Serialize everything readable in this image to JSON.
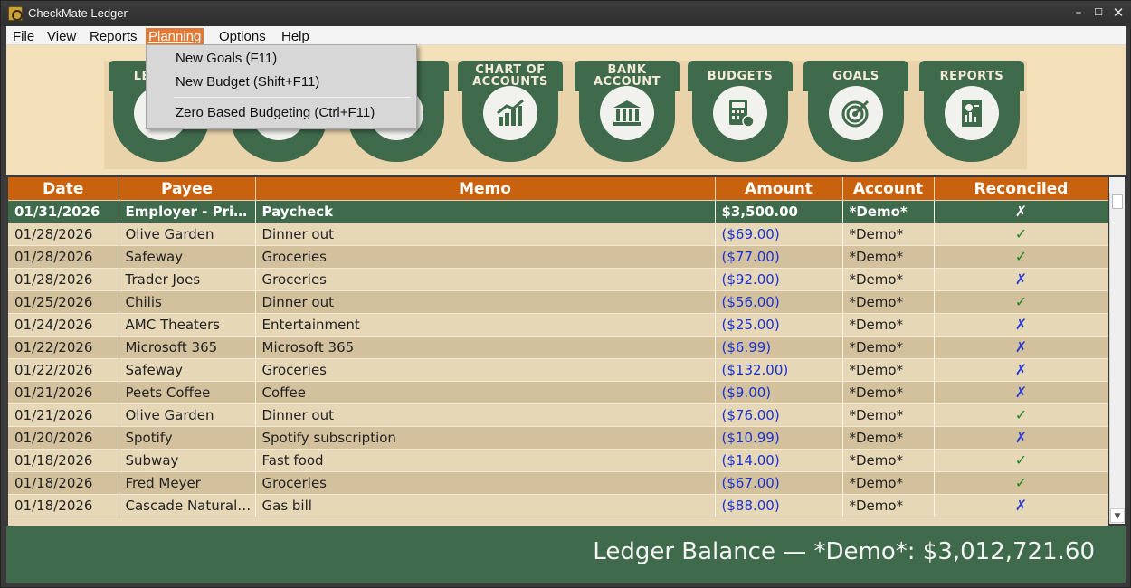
{
  "window": {
    "title": "CheckMate Ledger",
    "minimize": "–",
    "maximize": "☐",
    "close": "✕"
  },
  "menu": {
    "file": "File",
    "view": "View",
    "reports": "Reports",
    "planning": "Planning",
    "options": "Options",
    "help": "Help"
  },
  "planning_menu": [
    {
      "label": "New Goals (F11)"
    },
    {
      "label": "New Budget (Shift+F11)"
    },
    {
      "label": "Zero Based Budgeting (Ctrl+F11)"
    }
  ],
  "toolbar": [
    {
      "label": "LEDGER",
      "icon": "ledger-icon"
    },
    {
      "label": "",
      "icon": "transfer-icon"
    },
    {
      "label": "",
      "icon": "register-icon"
    },
    {
      "label": "CHART OF ACCOUNTS",
      "icon": "chart-growth-icon"
    },
    {
      "label": "BANK ACCOUNT",
      "icon": "bank-icon"
    },
    {
      "label": "BUDGETS",
      "icon": "calculator-icon"
    },
    {
      "label": "GOALS",
      "icon": "target-icon"
    },
    {
      "label": "REPORTS",
      "icon": "report-icon"
    }
  ],
  "table": {
    "columns": [
      "Date",
      "Payee",
      "Memo",
      "Amount",
      "Account",
      "Reconciled"
    ],
    "rows": [
      [
        "01/31/2026",
        "Employer - Primary Job",
        "Paycheck",
        "$3,500.00",
        "*Demo*",
        "✗"
      ],
      [
        "01/28/2026",
        "Olive Garden",
        "Dinner out",
        "($69.00)",
        "*Demo*",
        "✓"
      ],
      [
        "01/28/2026",
        "Safeway",
        "Groceries",
        "($77.00)",
        "*Demo*",
        "✓"
      ],
      [
        "01/28/2026",
        "Trader Joes",
        "Groceries",
        "($92.00)",
        "*Demo*",
        "✗"
      ],
      [
        "01/25/2026",
        "Chilis",
        "Dinner out",
        "($56.00)",
        "*Demo*",
        "✓"
      ],
      [
        "01/24/2026",
        "AMC Theaters",
        "Entertainment",
        "($25.00)",
        "*Demo*",
        "✗"
      ],
      [
        "01/22/2026",
        "Microsoft 365",
        "Microsoft 365",
        "($6.99)",
        "*Demo*",
        "✗"
      ],
      [
        "01/22/2026",
        "Safeway",
        "Groceries",
        "($132.00)",
        "*Demo*",
        "✗"
      ],
      [
        "01/21/2026",
        "Peets Coffee",
        "Coffee",
        "($9.00)",
        "*Demo*",
        "✗"
      ],
      [
        "01/21/2026",
        "Olive Garden",
        "Dinner out",
        "($76.00)",
        "*Demo*",
        "✓"
      ],
      [
        "01/20/2026",
        "Spotify",
        "Spotify subscription",
        "($10.99)",
        "*Demo*",
        "✗"
      ],
      [
        "01/18/2026",
        "Subway",
        "Fast food",
        "($14.00)",
        "*Demo*",
        "✓"
      ],
      [
        "01/18/2026",
        "Fred Meyer",
        "Groceries",
        "($67.00)",
        "*Demo*",
        "✓"
      ],
      [
        "01/18/2026",
        "Cascade Natural Gas",
        "Gas bill",
        "($88.00)",
        "*Demo*",
        "✗"
      ]
    ]
  },
  "footer": {
    "balance": "Ledger Balance — *Demo*: $3,012,721.60"
  },
  "colors": {
    "header": "#c9620f",
    "accent_green": "#3f6a4b",
    "menu_highlight": "#e07a36",
    "amount_blue": "#1a32d6",
    "check_green": "#23861f"
  }
}
